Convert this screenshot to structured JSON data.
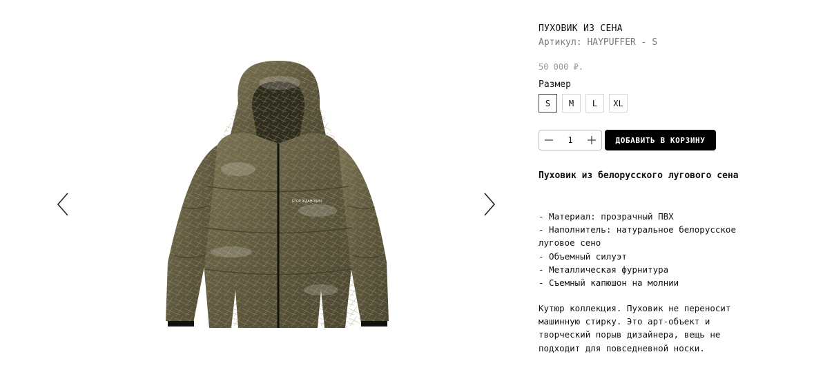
{
  "gallery": {
    "prev_icon": "chevron-left-icon",
    "next_icon": "chevron-right-icon",
    "jacket_brand_print": "ЕГОР ЖДАНОВИЧ"
  },
  "product": {
    "title": "ПУХОВИК ИЗ СЕНА",
    "sku": "Артикул: HAYPUFFER - S",
    "price": "50 000 ₽.",
    "size_label": "Размер",
    "sizes": [
      "S",
      "M",
      "L",
      "XL"
    ],
    "selected_size": "S",
    "quantity": "1",
    "add_to_cart": "ДОБАВИТЬ В КОРЗИНУ",
    "description_heading": "Пуховик из белорусского лугового сена",
    "features": [
      "- Материал: прозрачный ПВХ",
      "- Наполнитель: натуральное белорусское луговое сено",
      "- Объемный силуэт",
      "- Металлическая фурнитура",
      "- Съемный капюшон на молнии"
    ],
    "couture_text": "Кутюр коллекция. Пуховик не переносит машинную стирку. Это арт-объект и творческий порыв дизайнера, вещь не подходит для повседневной носки."
  },
  "colors": {
    "button_bg": "#000000",
    "button_text": "#ffffff",
    "price": "#9a9a9a",
    "sku": "#777777",
    "jacket": "#6b6448"
  }
}
